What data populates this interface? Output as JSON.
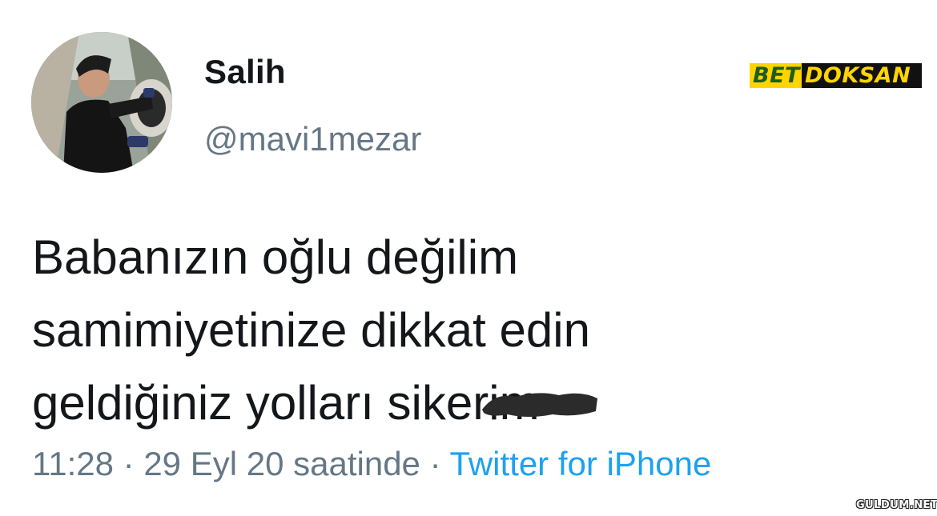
{
  "tweet": {
    "display_name": "Salih",
    "handle": "@mavi1mezar",
    "body_lines": [
      "Babanızın oğlu değilim",
      "samimiyetinize dikkat edin",
      "geldiğiniz yolları sikerim"
    ],
    "time": "11:28",
    "separator": " · ",
    "date": "29 Eyl 20 saatinde",
    "source": "Twitter for iPhone"
  },
  "logo": {
    "part1": "BET",
    "part2": "DOKSAN"
  },
  "watermark": "GULDUM.NET",
  "colors": {
    "text": "#14171a",
    "secondary": "#657786",
    "link": "#1da1f2",
    "logo_yellow": "#ffd400",
    "logo_dark": "#111111"
  },
  "icons": {
    "avatar": "profile-photo",
    "redaction": "marker-scribble"
  }
}
